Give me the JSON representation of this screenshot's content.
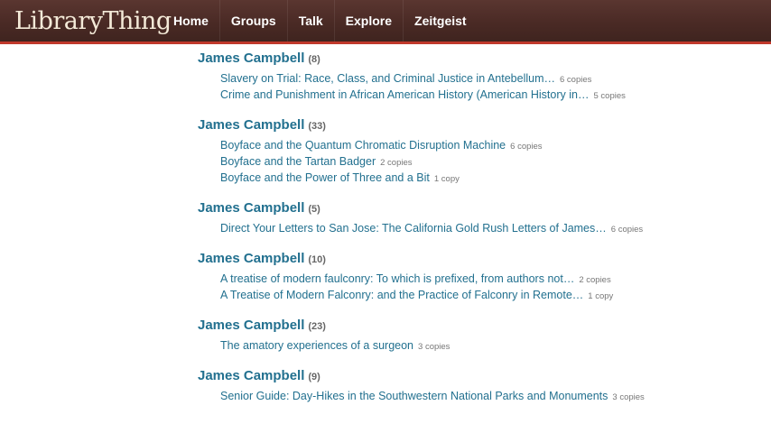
{
  "header": {
    "logo": "LibraryThing",
    "nav": [
      "Home",
      "Groups",
      "Talk",
      "Explore",
      "Zeitgeist"
    ]
  },
  "colors": {
    "header_bg": "#4a2a25",
    "accent_line": "#c0392b",
    "link": "#22708f"
  },
  "results": [
    {
      "author": "James Campbell",
      "count": "(8)",
      "books": [
        {
          "title": "Slavery on Trial: Race, Class, and Criminal Justice in Antebellum…",
          "copies": "6 copies"
        },
        {
          "title": "Crime and Punishment in African American History (American History in…",
          "copies": "5 copies"
        }
      ]
    },
    {
      "author": "James Campbell",
      "count": "(33)",
      "books": [
        {
          "title": "Boyface and the Quantum Chromatic Disruption Machine",
          "copies": "6 copies"
        },
        {
          "title": "Boyface and the Tartan Badger",
          "copies": "2 copies"
        },
        {
          "title": "Boyface and the Power of Three and a Bit",
          "copies": "1 copy"
        }
      ]
    },
    {
      "author": "James Campbell",
      "count": "(5)",
      "books": [
        {
          "title": "Direct Your Letters to San Jose: The California Gold Rush Letters of James…",
          "copies": "6 copies"
        }
      ]
    },
    {
      "author": "James Campbell",
      "count": "(10)",
      "books": [
        {
          "title": "A treatise of modern faulconry: To which is prefixed, from authors not…",
          "copies": "2 copies"
        },
        {
          "title": "A Treatise of Modern Falconry: and the Practice of Falconry in Remote…",
          "copies": "1 copy"
        }
      ]
    },
    {
      "author": "James Campbell",
      "count": "(23)",
      "books": [
        {
          "title": "The amatory experiences of a surgeon",
          "copies": "3 copies"
        }
      ]
    },
    {
      "author": "James Campbell",
      "count": "(9)",
      "books": [
        {
          "title": "Senior Guide: Day-Hikes in the Southwestern National Parks and Monuments",
          "copies": "3 copies"
        }
      ]
    }
  ]
}
